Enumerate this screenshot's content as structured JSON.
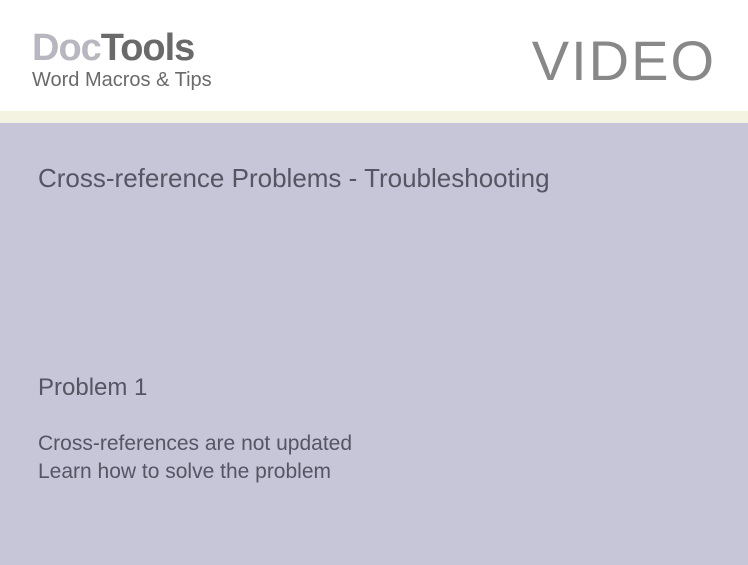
{
  "header": {
    "logo": {
      "part1": "Doc",
      "part2": "Tools",
      "subtitle": "Word Macros & Tips"
    },
    "video_label": "VIDEO"
  },
  "content": {
    "title": "Cross-reference Problems - Troubleshooting",
    "problem_heading": "Problem 1",
    "problem_line1": "Cross-references are not updated",
    "problem_line2": "Learn how to solve the problem"
  }
}
